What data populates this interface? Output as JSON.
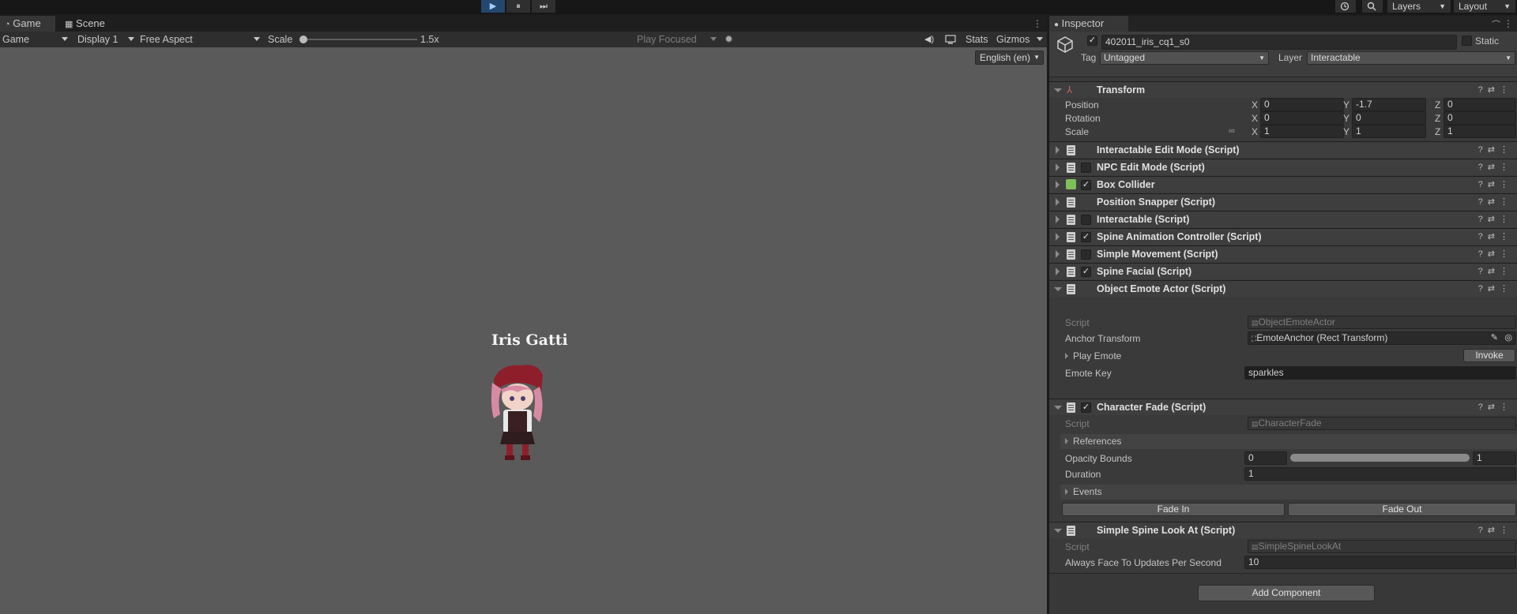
{
  "topbar": {
    "play_icon": "play-icon",
    "pause_icon": "pause-icon",
    "step_icon": "step-icon",
    "play": "▶",
    "pause": "⏸",
    "step": "⏭",
    "layers": "Layers",
    "layout": "Layout"
  },
  "game": {
    "tabs": [
      "Game",
      "Scene"
    ],
    "display_mode": "Game",
    "display": "Display 1",
    "aspect": "Free Aspect",
    "scale_label": "Scale",
    "scale_value": "1.5x",
    "play_focused": "Play Focused",
    "stats": "Stats",
    "gizmos": "Gizmos",
    "language": "English (en)",
    "character_name": "Iris Gatti"
  },
  "inspector": {
    "tab": "Inspector",
    "object_name": "402011_iris_cq1_s0",
    "static_label": "Static",
    "tag_label": "Tag",
    "tag_value": "Untagged",
    "layer_label": "Layer",
    "layer_value": "Interactable",
    "transform": {
      "title": "Transform",
      "rows": [
        {
          "label": "Position",
          "x": "0",
          "y": "-1.7",
          "z": "0"
        },
        {
          "label": "Rotation",
          "x": "0",
          "y": "0",
          "z": "0"
        },
        {
          "label": "Scale",
          "x": "1",
          "y": "1",
          "z": "1"
        }
      ]
    },
    "components": [
      {
        "name": "Interactable Edit Mode (Script)",
        "checked": false
      },
      {
        "name": "NPC Edit Mode (Script)",
        "checked": false
      },
      {
        "name": "Box Collider",
        "checked": true
      },
      {
        "name": "Position Snapper (Script)",
        "checked": false
      },
      {
        "name": "Interactable (Script)",
        "checked": false
      },
      {
        "name": "Spine Animation Controller (Script)",
        "checked": true
      },
      {
        "name": "Simple Movement (Script)",
        "checked": false
      },
      {
        "name": "Spine Facial (Script)",
        "checked": true
      }
    ],
    "emote_actor": {
      "title": "Object Emote Actor (Script)",
      "script_label": "Script",
      "script_value": "ObjectEmoteActor",
      "anchor_label": "Anchor Transform",
      "anchor_value": "EmoteAnchor (Rect Transform)",
      "play_emote": "Play Emote",
      "invoke": "Invoke",
      "emote_key_label": "Emote Key",
      "emote_key_value": "sparkles"
    },
    "character_fade": {
      "title": "Character Fade (Script)",
      "script_label": "Script",
      "script_value": "CharacterFade",
      "references": "References",
      "opacity_label": "Opacity Bounds",
      "opacity_min": "0",
      "opacity_max": "1",
      "duration_label": "Duration",
      "duration_value": "1",
      "events": "Events",
      "fade_in": "Fade In",
      "fade_out": "Fade Out"
    },
    "look_at": {
      "title": "Simple Spine Look At (Script)",
      "script_label": "Script",
      "script_value": "SimpleSpineLookAt",
      "updates_label": "Always Face To Updates Per Second",
      "updates_value": "10"
    },
    "add_component": "Add Component"
  }
}
